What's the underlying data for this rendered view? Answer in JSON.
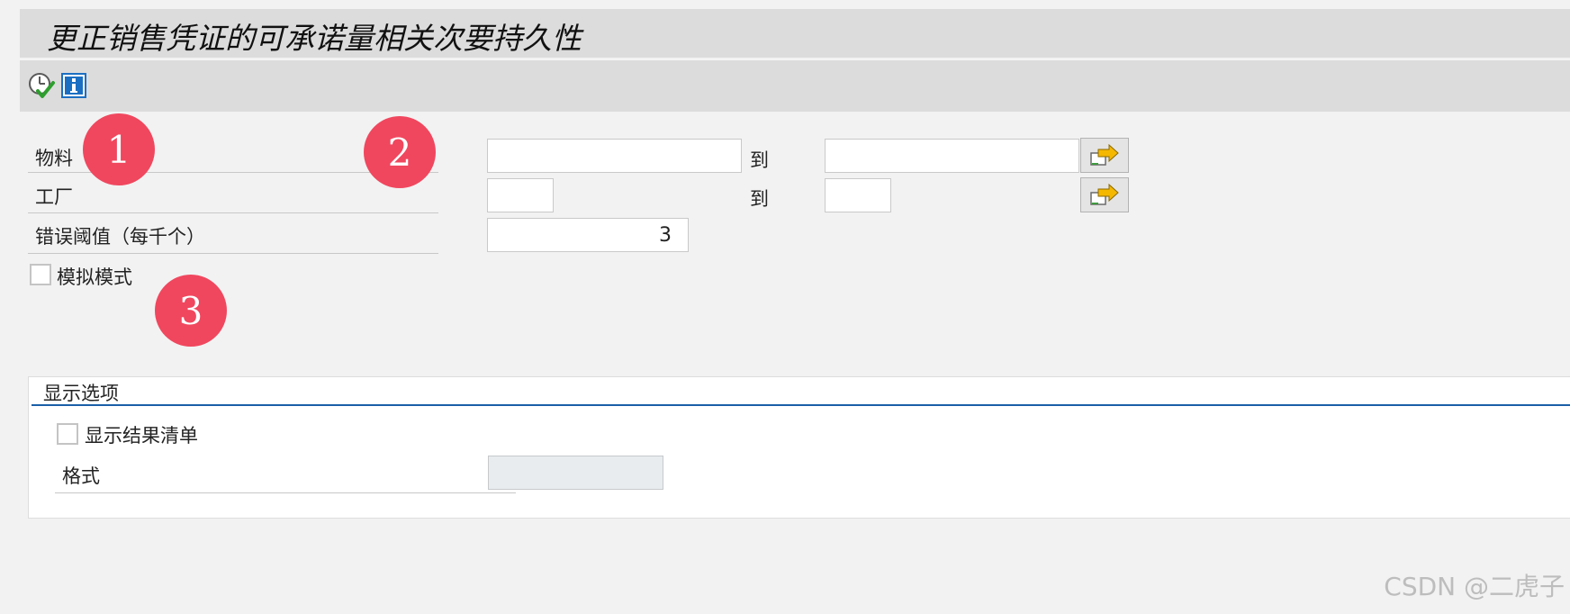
{
  "title": "更正销售凭证的可承诺量相关次要持久性",
  "toolbar": {
    "execute_icon": "execute-clock-check-icon",
    "info_icon": "info-icon"
  },
  "fields": {
    "material": {
      "label": "物料",
      "from": "",
      "to_label": "到",
      "to": ""
    },
    "plant": {
      "label": "工厂",
      "from": "",
      "to_label": "到",
      "to": ""
    },
    "error_threshold": {
      "label": "错误阈值（每千个）",
      "value": "3"
    }
  },
  "simulation_mode": {
    "label": "模拟模式",
    "checked": false
  },
  "display_options": {
    "title": "显示选项",
    "show_result_list": {
      "label": "显示结果清单",
      "checked": false
    },
    "format": {
      "label": "格式",
      "value": ""
    }
  },
  "annotations": [
    "1",
    "2",
    "3"
  ],
  "watermark": "CSDN @二虎子",
  "colors": {
    "badge": "#f0475e",
    "group_line": "#1a5fa8",
    "header_bg": "#dcdcdc"
  }
}
